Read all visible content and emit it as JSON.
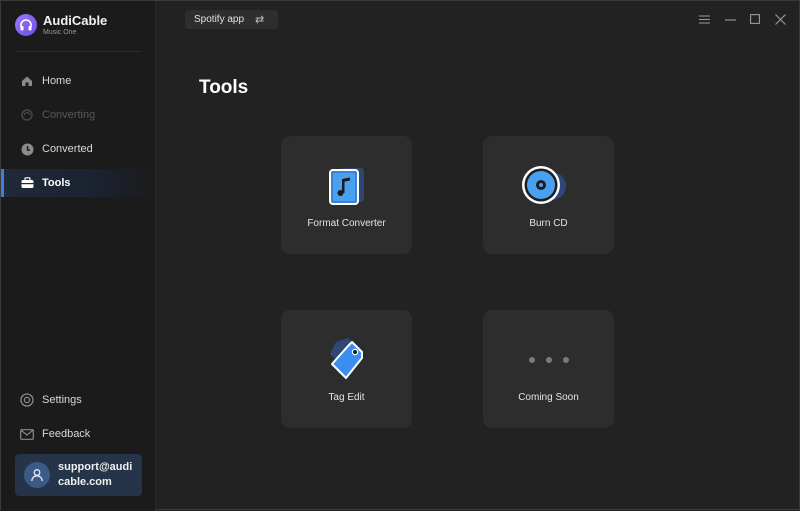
{
  "app": {
    "name": "AudiCable",
    "subtitle": "Music One"
  },
  "sidebar": {
    "items": [
      {
        "label": "Home",
        "icon": "home-icon",
        "state": "normal"
      },
      {
        "label": "Converting",
        "icon": "converting-icon",
        "state": "disabled"
      },
      {
        "label": "Converted",
        "icon": "clock-icon",
        "state": "normal"
      },
      {
        "label": "Tools",
        "icon": "toolbox-icon",
        "state": "active"
      }
    ],
    "bottom_items": [
      {
        "label": "Settings",
        "icon": "settings-icon"
      },
      {
        "label": "Feedback",
        "icon": "mail-icon"
      }
    ],
    "support_email": "support@audicable.com"
  },
  "topbar": {
    "source_label": "Spotify app",
    "swap_icon": "swap-icon"
  },
  "main": {
    "title": "Tools",
    "tools": [
      {
        "label": "Format Converter",
        "icon": "format-converter-icon"
      },
      {
        "label": "Burn CD",
        "icon": "burn-cd-icon"
      },
      {
        "label": "Tag Edit",
        "icon": "tag-edit-icon"
      },
      {
        "label": "Coming Soon",
        "icon": "more-dots-icon"
      }
    ]
  },
  "colors": {
    "accent": "#3d7be6",
    "sidebar_bg": "#1b1b1b",
    "main_bg": "#222222",
    "card_bg": "#2d2d2d"
  }
}
